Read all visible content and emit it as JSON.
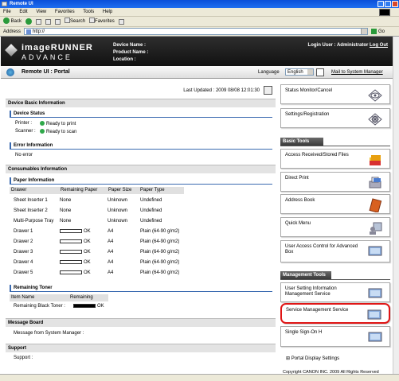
{
  "window": {
    "title": "Remote UI"
  },
  "menu": [
    "File",
    "Edit",
    "View",
    "Favorites",
    "Tools",
    "Help"
  ],
  "toolbar": {
    "back": "Back",
    "forward": "",
    "search": "Search",
    "favorites": "Favorites"
  },
  "address": {
    "label": "Address",
    "value": "http://",
    "go": "Go"
  },
  "header": {
    "brand_line1": "imageRUNNER",
    "brand_line2": "ADVANCE",
    "device_name": "Device Name :",
    "product_name": "Product Name :",
    "location": "Location :",
    "login_user": "Login User : Administrator",
    "logout": "Log Out"
  },
  "portal": {
    "title": "Remote UI : Portal",
    "language_label": "Language",
    "language_value": "English",
    "mail": "Mail to System Manager"
  },
  "main": {
    "last_updated": "Last Updated : 2009 08/08 12:01:30",
    "device_basic": "Device Basic Information",
    "device_status": "Device Status",
    "printer_label": "Printer :",
    "printer_status": "Ready to print",
    "scanner_label": "Scanner :",
    "scanner_status": "Ready to scan",
    "error_info": "Error Information",
    "error_text": "No error",
    "consumables": "Consumables Information",
    "paper_info": "Paper Information",
    "paper_headers": [
      "Drawer",
      "Remaining Paper",
      "Paper Size",
      "Paper Type"
    ],
    "paper_rows": [
      {
        "drawer": "Sheet Inserter 1",
        "remaining": "None",
        "size": "Unknown",
        "type": "Undefined"
      },
      {
        "drawer": "Sheet Inserter 2",
        "remaining": "None",
        "size": "Unknown",
        "type": "Undefined"
      },
      {
        "drawer": "Multi-Purpose Tray",
        "remaining": "None",
        "size": "Unknown",
        "type": "Undefined"
      },
      {
        "drawer": "Drawer 1",
        "remaining": "OK",
        "size": "A4",
        "type": "Plain (64-90 g/m2)"
      },
      {
        "drawer": "Drawer 2",
        "remaining": "OK",
        "size": "A4",
        "type": "Plain (64-90 g/m2)"
      },
      {
        "drawer": "Drawer 3",
        "remaining": "OK",
        "size": "A4",
        "type": "Plain (64-90 g/m2)"
      },
      {
        "drawer": "Drawer 4",
        "remaining": "OK",
        "size": "A4",
        "type": "Plain (64-90 g/m2)"
      },
      {
        "drawer": "Drawer 5",
        "remaining": "OK",
        "size": "A4",
        "type": "Plain (64-90 g/m2)"
      }
    ],
    "remaining_toner": "Remaining Toner",
    "toner_headers": [
      "Item Name",
      "Remaining"
    ],
    "toner_item": "Remaining Black Toner :",
    "toner_value": "OK",
    "message_board": "Message Board",
    "message_text": "Message from System Manager :",
    "support": "Support",
    "support_text": "Support :"
  },
  "side": {
    "status_monitor": "Status Monitor/Cancel",
    "settings": "Settings/Registration",
    "basic_tools": "Basic Tools",
    "access_received": "Access Received/Stored Files",
    "direct_print": "Direct Print",
    "address_book": "Address Book",
    "quick_menu": "Quick Menu",
    "user_access": "User Access Control for Advanced Box",
    "management_tools": "Management Tools",
    "user_setting": "User Setting Information Management Service",
    "service_mgmt": "Service Management Service",
    "sso": "Single Sign-On H",
    "portal_display": "Portal Display Settings",
    "copyright": "Copyright CANON INC. 2009 All Rights Reserved"
  },
  "colors": {
    "header_bg": "#1a1a1a",
    "highlight": "#e01515",
    "status_ok": "#2fa84a"
  }
}
